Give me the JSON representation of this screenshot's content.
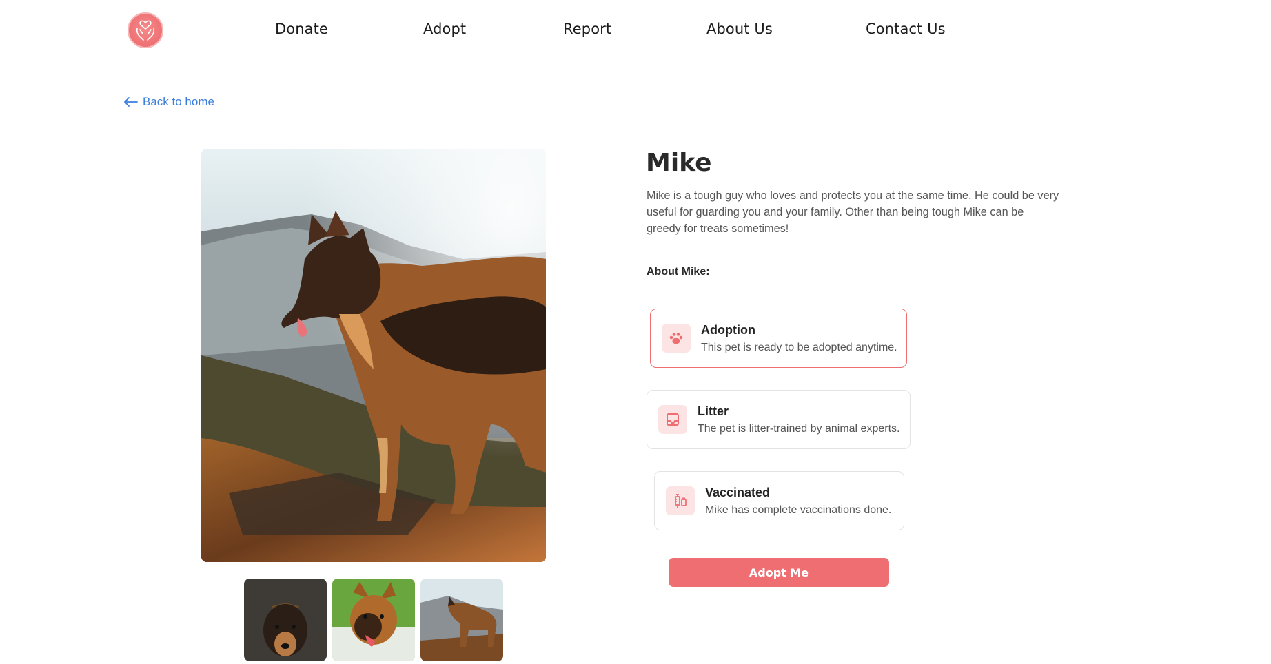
{
  "nav": {
    "links": [
      "Donate",
      "Adopt",
      "Report",
      "About Us",
      "Contact Us"
    ]
  },
  "back_link": "Back to home",
  "pet": {
    "name": "Mike",
    "description": "Mike is a tough guy who loves and protects you at the same time. He could be very useful for guarding you and your family. Other than being tough Mike can be greedy for treats sometimes!",
    "about_label": "About Mike:"
  },
  "features": [
    {
      "title": "Adoption",
      "text": "This pet is ready to be adopted anytime.",
      "icon": "paw-icon"
    },
    {
      "title": "Litter",
      "text": "The pet is litter-trained by animal experts.",
      "icon": "inbox-tray-icon"
    },
    {
      "title": "Vaccinated",
      "text": "Mike has complete vaccinations done.",
      "icon": "syringe-icon"
    }
  ],
  "adopt_button": "Adopt Me",
  "colors": {
    "accent": "#ef6e72",
    "link": "#3b7ddd",
    "icon_bg": "#fde4e4"
  }
}
